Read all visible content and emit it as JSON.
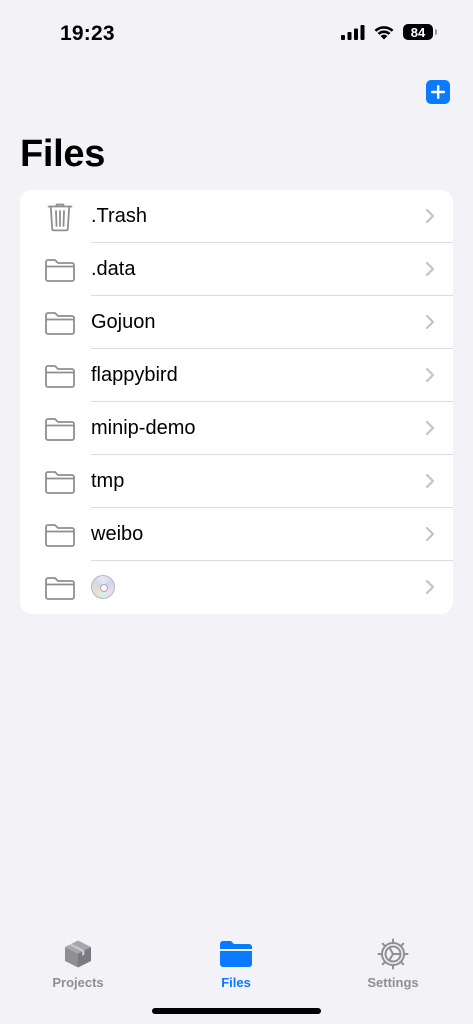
{
  "status_bar": {
    "time": "19:23",
    "battery": "84"
  },
  "header": {
    "title": "Files",
    "add_button_icon": "plus-icon"
  },
  "files": [
    {
      "label": ".Trash",
      "icon": "trash-icon"
    },
    {
      "label": ".data",
      "icon": "folder-icon"
    },
    {
      "label": "Gojuon",
      "icon": "folder-icon"
    },
    {
      "label": "flappybird",
      "icon": "folder-icon"
    },
    {
      "label": "minip-demo",
      "icon": "folder-icon"
    },
    {
      "label": "tmp",
      "icon": "folder-icon"
    },
    {
      "label": "weibo",
      "icon": "folder-icon"
    },
    {
      "label": "💿",
      "icon": "folder-icon"
    }
  ],
  "tab_bar": {
    "tabs": [
      {
        "label": "Projects",
        "icon": "box-icon"
      },
      {
        "label": "Files",
        "icon": "folder-filled-icon",
        "active": true
      },
      {
        "label": "Settings",
        "icon": "gear-icon"
      }
    ]
  },
  "colors": {
    "accent": "#0a7aff",
    "background": "#f2f2f7",
    "inactive": "#8e8e93",
    "icon_gray": "#8e8e93"
  }
}
